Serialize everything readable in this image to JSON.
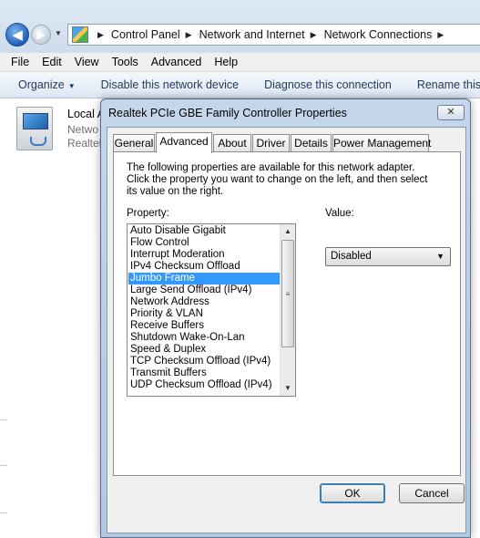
{
  "breadcrumb": [
    "Control Panel",
    "Network and Internet",
    "Network Connections"
  ],
  "menubar": [
    "File",
    "Edit",
    "View",
    "Tools",
    "Advanced",
    "Help"
  ],
  "commandbar": {
    "organize": "Organize",
    "disable": "Disable this network device",
    "diagnose": "Diagnose this connection",
    "rename": "Rename this c"
  },
  "connection": {
    "name": "Local A",
    "line2": "Netwo",
    "line3": "Realtek"
  },
  "dialog": {
    "title": "Realtek PCIe GBE Family Controller Properties",
    "close_label": "✕",
    "tabs": [
      "General",
      "Advanced",
      "About",
      "Driver",
      "Details",
      "Power Management"
    ],
    "active_tab": "Advanced",
    "description": "The following properties are available for this network adapter. Click the property you want to change on the left, and then select its value on the right.",
    "property_label": "Property:",
    "value_label": "Value:",
    "properties": [
      "Auto Disable Gigabit",
      "Flow Control",
      "Interrupt Moderation",
      "IPv4 Checksum Offload",
      "Jumbo Frame",
      "Large Send Offload (IPv4)",
      "Network Address",
      "Priority & VLAN",
      "Receive Buffers",
      "Shutdown Wake-On-Lan",
      "Speed & Duplex",
      "TCP Checksum Offload (IPv4)",
      "Transmit Buffers",
      "UDP Checksum Offload (IPv4)"
    ],
    "selected_property": "Jumbo Frame",
    "value": "Disabled",
    "ok_label": "OK",
    "cancel_label": "Cancel"
  },
  "colors": {
    "selection": "#3399ff",
    "title_bar": "#c4d6ea"
  }
}
